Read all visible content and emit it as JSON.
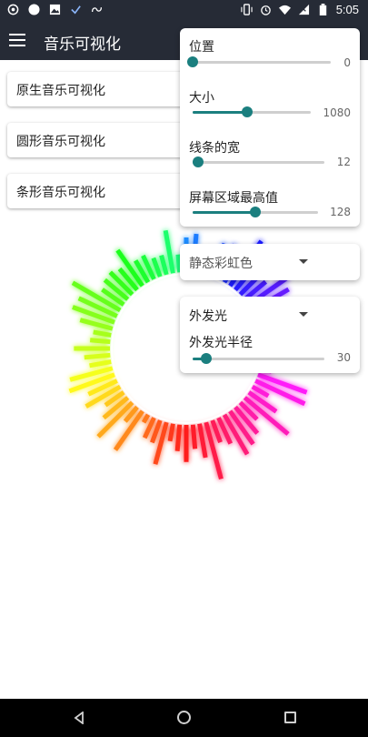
{
  "status_bar": {
    "time": "5:05"
  },
  "app_bar": {
    "title": "音乐可视化"
  },
  "cards": [
    {
      "label": "原生音乐可视化"
    },
    {
      "label": "圆形音乐可视化"
    },
    {
      "label": "条形音乐可视化"
    }
  ],
  "panel": {
    "sliders": [
      {
        "label": "位置",
        "value": "0",
        "fraction": 0.0
      },
      {
        "label": "大小",
        "value": "1080",
        "fraction": 0.46
      },
      {
        "label": "线条的宽",
        "value": "12",
        "fraction": 0.04
      },
      {
        "label": "屏幕区域最高值",
        "value": "128",
        "fraction": 0.5
      }
    ]
  },
  "color_dropdown": {
    "selected": "静态彩虹色"
  },
  "glow": {
    "dropdown_selected": "外发光",
    "radius_label": "外发光半径",
    "radius_value": "30",
    "radius_fraction": 0.1
  },
  "colors": {
    "accent": "#1b7f7f",
    "app_bar": "#262b36"
  }
}
